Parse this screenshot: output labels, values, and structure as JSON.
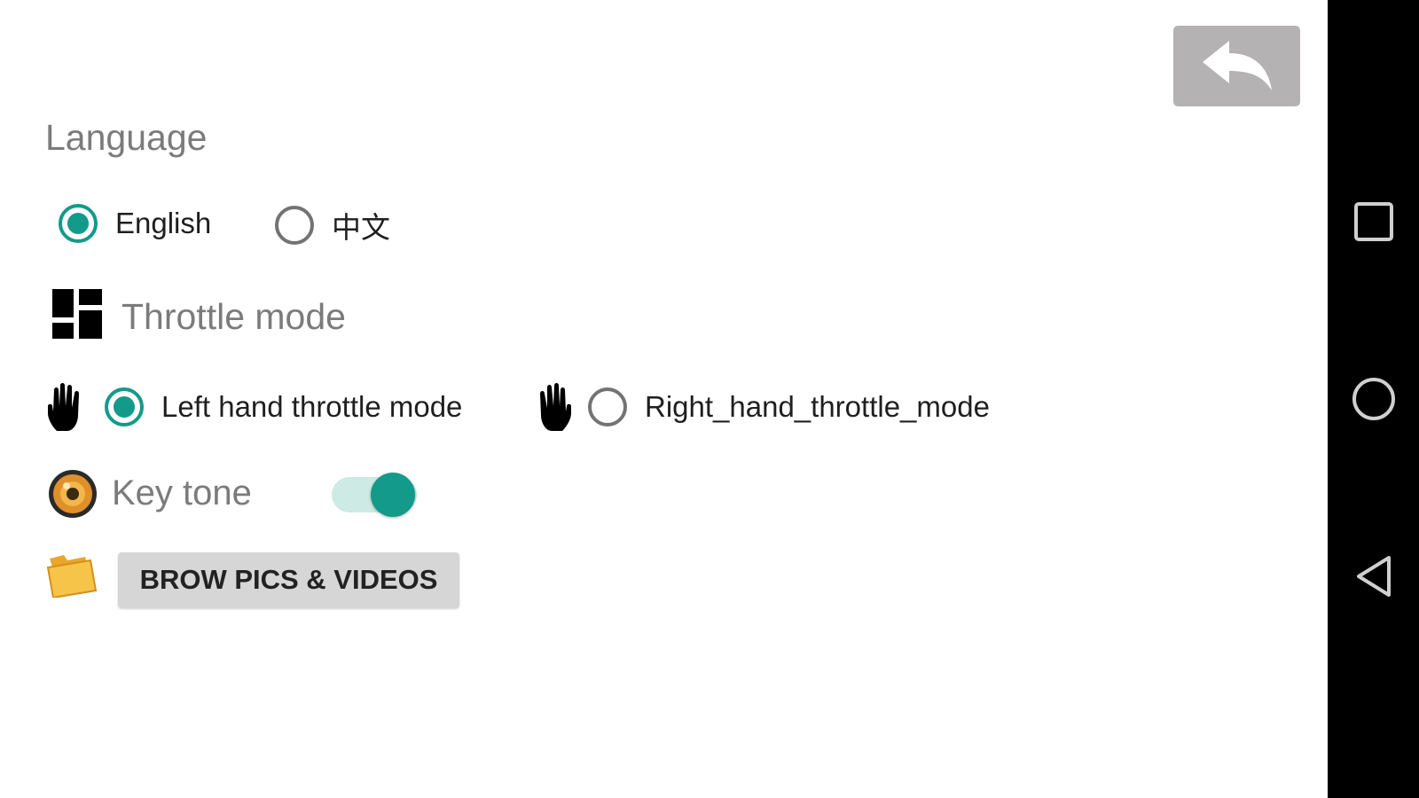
{
  "header": {
    "back_icon": "reply-arrow-icon"
  },
  "language": {
    "title": "Language",
    "options": [
      {
        "label": "English",
        "selected": true
      },
      {
        "label": "中文",
        "selected": false
      }
    ]
  },
  "throttle": {
    "title": "Throttle mode",
    "icon": "dashboard-grid-icon",
    "options": [
      {
        "label": "Left hand throttle mode",
        "selected": true,
        "icon": "left-hand-icon"
      },
      {
        "label": "Right_hand_throttle_mode",
        "selected": false,
        "icon": "right-hand-icon"
      }
    ]
  },
  "key_tone": {
    "label": "Key tone",
    "enabled": true,
    "icon": "speaker-icon"
  },
  "browse": {
    "label": "BROW PICS & VIDEOS",
    "icon": "folder-icon"
  },
  "navbar": {
    "icons": [
      "recents-square-icon",
      "home-circle-icon",
      "back-triangle-icon"
    ]
  },
  "colors": {
    "accent": "#139a8a",
    "toggle_track": "#cdeae5",
    "back_button_bg": "#b4b2b2"
  }
}
